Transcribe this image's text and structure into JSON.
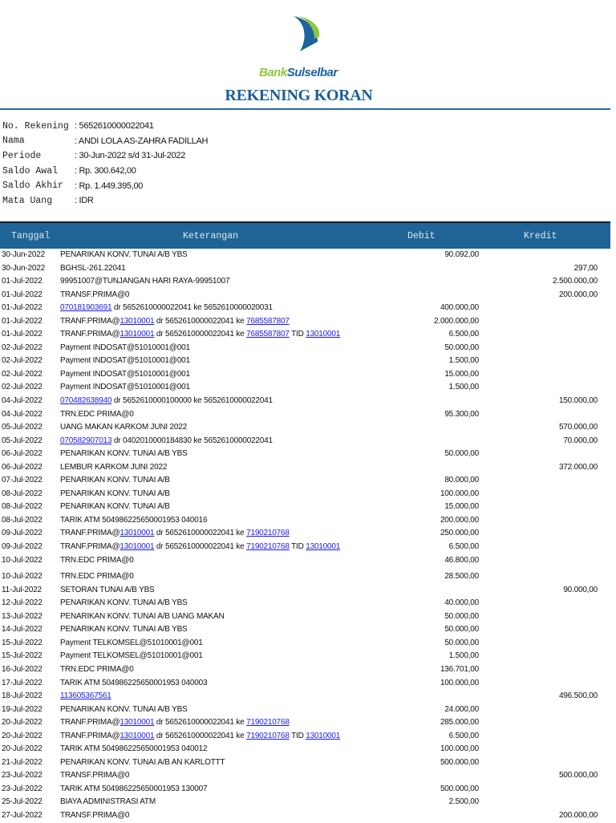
{
  "header": {
    "logo": {
      "part1": "Bank",
      "part2": "Sulselbar"
    },
    "title": "REKENING KORAN"
  },
  "account": [
    {
      "label": "No. Rekening",
      "value": "5652610000022041"
    },
    {
      "label": "Nama",
      "value": "ANDI LOLA AS-ZAHRA FADILLAH"
    },
    {
      "label": "Periode",
      "value": "30-Jun-2022 s/d 31-Jul-2022"
    },
    {
      "label": "Saldo Awal",
      "value": "Rp. 300.642,00"
    },
    {
      "label": "Saldo Akhir",
      "value": "Rp. 1.449.395,00"
    },
    {
      "label": "Mata Uang",
      "value": "IDR"
    }
  ],
  "colors": {
    "header_bg": "#1f6496",
    "title": "#1c5f96",
    "link": "#1a1aee",
    "logo_green": "#8dc63f"
  },
  "table": {
    "columns": {
      "date": "Tanggal",
      "desc": "Keterangan",
      "debit": "Debit",
      "kredit": "Kredit"
    },
    "rows": [
      {
        "date": "30-Jun-2022",
        "desc": [
          {
            "t": "PENARIKAN KONV. TUNAI A/B YBS"
          }
        ],
        "debit": "90.092,00",
        "kredit": ""
      },
      {
        "date": "30-Jun-2022",
        "desc": [
          {
            "t": "BGHSL-261.22041"
          }
        ],
        "debit": "",
        "kredit": "297,00"
      },
      {
        "date": "01-Jul-2022",
        "desc": [
          {
            "t": "99951007@TUNJANGAN HARI RAYA-99951007"
          }
        ],
        "debit": "",
        "kredit": "2.500.000,00"
      },
      {
        "date": "01-Jul-2022",
        "desc": [
          {
            "t": "TRANSF.PRIMA@0"
          }
        ],
        "debit": "",
        "kredit": "200.000,00"
      },
      {
        "date": "01-Jul-2022",
        "desc": [
          {
            "t": "070181903691",
            "link": true
          },
          {
            "t": " dr 5652610000022041 ke 5652610000020031"
          }
        ],
        "debit": "400.000,00",
        "kredit": ""
      },
      {
        "date": "01-Jul-2022",
        "desc": [
          {
            "t": "TRANF.PRIMA@"
          },
          {
            "t": "13010001",
            "link": true
          },
          {
            "t": " dr 5652610000022041 ke "
          },
          {
            "t": "7685587807",
            "link": true
          }
        ],
        "debit": "2.000.000,00",
        "kredit": ""
      },
      {
        "date": "01-Jul-2022",
        "desc": [
          {
            "t": "TRANF.PRIMA@"
          },
          {
            "t": "13010001",
            "link": true
          },
          {
            "t": " dr 5652610000022041 ke "
          },
          {
            "t": "7685587807",
            "link": true
          },
          {
            "t": " TID "
          },
          {
            "t": "13010001",
            "link": true
          }
        ],
        "debit": "6.500,00",
        "kredit": ""
      },
      {
        "date": "02-Jul-2022",
        "desc": [
          {
            "t": "Payment INDOSAT@51010001@001"
          }
        ],
        "debit": "50.000,00",
        "kredit": ""
      },
      {
        "date": "02-Jul-2022",
        "desc": [
          {
            "t": "Payment INDOSAT@51010001@001"
          }
        ],
        "debit": "1.500,00",
        "kredit": ""
      },
      {
        "date": "02-Jul-2022",
        "desc": [
          {
            "t": "Payment INDOSAT@51010001@001"
          }
        ],
        "debit": "15.000,00",
        "kredit": ""
      },
      {
        "date": "02-Jul-2022",
        "desc": [
          {
            "t": "Payment INDOSAT@51010001@001"
          }
        ],
        "debit": "1.500,00",
        "kredit": ""
      },
      {
        "date": "04-Jul-2022",
        "desc": [
          {
            "t": "070482638940",
            "link": true
          },
          {
            "t": " dr 5652610000100000 ke 5652610000022041"
          }
        ],
        "debit": "",
        "kredit": "150.000,00"
      },
      {
        "date": "04-Jul-2022",
        "desc": [
          {
            "t": "TRN.EDC PRIMA@0"
          }
        ],
        "debit": "95.300,00",
        "kredit": ""
      },
      {
        "date": "05-Jul-2022",
        "desc": [
          {
            "t": "UANG MAKAN KARKOM JUNI 2022"
          }
        ],
        "debit": "",
        "kredit": "570.000,00"
      },
      {
        "date": "05-Jul-2022",
        "desc": [
          {
            "t": "070582907013",
            "link": true
          },
          {
            "t": " dr 0402010000184830 ke 5652610000022041"
          }
        ],
        "debit": "",
        "kredit": "70.000,00"
      },
      {
        "date": "06-Jul-2022",
        "desc": [
          {
            "t": "PENARIKAN KONV. TUNAI A/B YBS"
          }
        ],
        "debit": "50.000,00",
        "kredit": ""
      },
      {
        "date": "06-Jul-2022",
        "desc": [
          {
            "t": "LEMBUR KARKOM JUNI 2022"
          }
        ],
        "debit": "",
        "kredit": "372.000,00"
      },
      {
        "date": "07-Jul-2022",
        "desc": [
          {
            "t": "PENARIKAN KONV. TUNAI A/B"
          }
        ],
        "debit": "80.000,00",
        "kredit": ""
      },
      {
        "date": "08-Jul-2022",
        "desc": [
          {
            "t": "PENARIKAN KONV. TUNAI A/B"
          }
        ],
        "debit": "100.000,00",
        "kredit": ""
      },
      {
        "date": "08-Jul-2022",
        "desc": [
          {
            "t": "PENARIKAN KONV. TUNAI A/B"
          }
        ],
        "debit": "15.000,00",
        "kredit": ""
      },
      {
        "date": "08-Jul-2022",
        "desc": [
          {
            "t": "TARIK ATM 504986225650001953 040016"
          }
        ],
        "debit": "200.000,00",
        "kredit": ""
      },
      {
        "date": "09-Jul-2022",
        "desc": [
          {
            "t": "TRANF.PRIMA@"
          },
          {
            "t": "13010001",
            "link": true
          },
          {
            "t": " dr 5652610000022041 ke "
          },
          {
            "t": "7190210768",
            "link": true
          }
        ],
        "debit": "250.000,00",
        "kredit": ""
      },
      {
        "date": "09-Jul-2022",
        "desc": [
          {
            "t": "TRANF.PRIMA@"
          },
          {
            "t": "13010001",
            "link": true
          },
          {
            "t": " dr 5652610000022041 ke "
          },
          {
            "t": "7190210768",
            "link": true
          },
          {
            "t": " TID "
          },
          {
            "t": "13010001",
            "link": true
          }
        ],
        "debit": "6.500,00",
        "kredit": ""
      },
      {
        "date": "10-Jul-2022",
        "desc": [
          {
            "t": "TRN.EDC PRIMA@0"
          }
        ],
        "debit": "46.800,00",
        "kredit": ""
      },
      {
        "date": "10-Jul-2022",
        "desc": [
          {
            "t": "TRN.EDC PRIMA@0"
          }
        ],
        "debit": "28.500,00",
        "kredit": "",
        "gap": true
      },
      {
        "date": "11-Jul-2022",
        "desc": [
          {
            "t": "SETORAN TUNAI A/B YBS"
          }
        ],
        "debit": "",
        "kredit": "90.000,00"
      },
      {
        "date": "12-Jul-2022",
        "desc": [
          {
            "t": "PENARIKAN KONV. TUNAI A/B YBS"
          }
        ],
        "debit": "40.000,00",
        "kredit": ""
      },
      {
        "date": "13-Jul-2022",
        "desc": [
          {
            "t": "PENARIKAN KONV. TUNAI A/B UANG MAKAN"
          }
        ],
        "debit": "50.000,00",
        "kredit": ""
      },
      {
        "date": "14-Jul-2022",
        "desc": [
          {
            "t": "PENARIKAN KONV. TUNAI A/B YBS"
          }
        ],
        "debit": "50.000,00",
        "kredit": ""
      },
      {
        "date": "15-Jul-2022",
        "desc": [
          {
            "t": "Payment TELKOMSEL@51010001@001"
          }
        ],
        "debit": "50.000,00",
        "kredit": ""
      },
      {
        "date": "15-Jul-2022",
        "desc": [
          {
            "t": "Payment TELKOMSEL@51010001@001"
          }
        ],
        "debit": "1.500,00",
        "kredit": ""
      },
      {
        "date": "16-Jul-2022",
        "desc": [
          {
            "t": "TRN.EDC PRIMA@0"
          }
        ],
        "debit": "136.701,00",
        "kredit": ""
      },
      {
        "date": "17-Jul-2022",
        "desc": [
          {
            "t": "TARIK ATM 504986225650001953 040003"
          }
        ],
        "debit": "100.000,00",
        "kredit": ""
      },
      {
        "date": "18-Jul-2022",
        "desc": [
          {
            "t": "113605367561",
            "link": true
          }
        ],
        "debit": "",
        "kredit": "496.500,00"
      },
      {
        "date": "19-Jul-2022",
        "desc": [
          {
            "t": "PENARIKAN KONV. TUNAI A/B YBS"
          }
        ],
        "debit": "24.000,00",
        "kredit": ""
      },
      {
        "date": "20-Jul-2022",
        "desc": [
          {
            "t": "TRANF.PRIMA@"
          },
          {
            "t": "13010001",
            "link": true
          },
          {
            "t": " dr 5652610000022041 ke "
          },
          {
            "t": "7190210768",
            "link": true
          }
        ],
        "debit": "285.000,00",
        "kredit": ""
      },
      {
        "date": "20-Jul-2022",
        "desc": [
          {
            "t": "TRANF.PRIMA@"
          },
          {
            "t": "13010001",
            "link": true
          },
          {
            "t": " dr 5652610000022041 ke "
          },
          {
            "t": "7190210768",
            "link": true
          },
          {
            "t": " TID "
          },
          {
            "t": "13010001",
            "link": true
          }
        ],
        "debit": "6.500,00",
        "kredit": ""
      },
      {
        "date": "20-Jul-2022",
        "desc": [
          {
            "t": "TARIK ATM 504986225650001953 040012"
          }
        ],
        "debit": "100.000,00",
        "kredit": ""
      },
      {
        "date": "21-Jul-2022",
        "desc": [
          {
            "t": "PENARIKAN KONV. TUNAI A/B AN KARLOTTT"
          }
        ],
        "debit": "500.000,00",
        "kredit": ""
      },
      {
        "date": "23-Jul-2022",
        "desc": [
          {
            "t": "TRANSF.PRIMA@0"
          }
        ],
        "debit": "",
        "kredit": "500.000,00"
      },
      {
        "date": "23-Jul-2022",
        "desc": [
          {
            "t": "TARIK ATM 504986225650001953 130007"
          }
        ],
        "debit": "500.000,00",
        "kredit": ""
      },
      {
        "date": "25-Jul-2022",
        "desc": [
          {
            "t": "BIAYA ADMINISTRASI ATM"
          }
        ],
        "debit": "2.500,00",
        "kredit": ""
      },
      {
        "date": "27-Jul-2022",
        "desc": [
          {
            "t": "TRANSF.PRIMA@0"
          }
        ],
        "debit": "",
        "kredit": "200.000,00"
      }
    ]
  }
}
